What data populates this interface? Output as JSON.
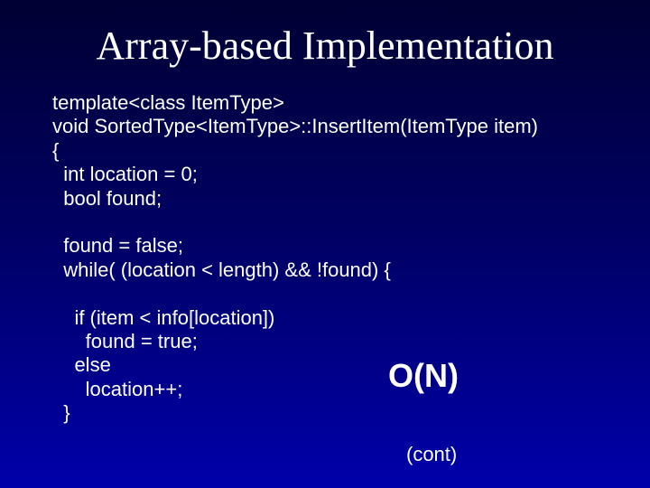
{
  "slide": {
    "title": "Array-based Implementation",
    "code": {
      "l1": "template<class ItemType>",
      "l2": "void SortedType<ItemType>::InsertItem(ItemType item)",
      "l3": "{",
      "l4": "  int location = 0;",
      "l5": "  bool found;",
      "l6": "",
      "l7": "  found = false;",
      "l8": "  while( (location < length) && !found) {",
      "l9": "",
      "l10": "    if (item < info[location])",
      "l11": "      found = true;",
      "l12": "    else",
      "l13": "      location++;",
      "l14": "  }"
    },
    "complexity": "O(N)",
    "continuation": "(cont)"
  }
}
